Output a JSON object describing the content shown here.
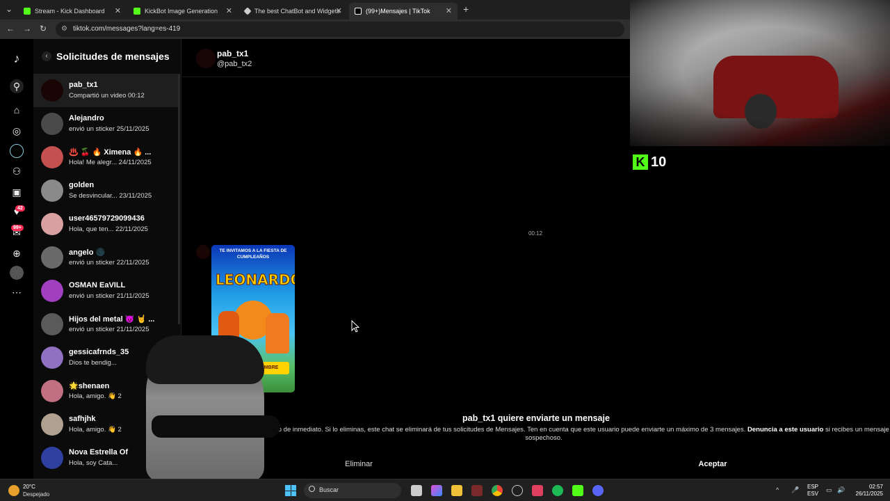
{
  "browser": {
    "tabs": [
      {
        "title": "Stream - Kick Dashboard",
        "color": "#53fc18"
      },
      {
        "title": "KickBot Image Generation",
        "color": "#53fc18"
      },
      {
        "title": "The best ChatBot and Widgets",
        "color": "#cccccc"
      },
      {
        "title": "(99+)Mensajes | TikTok",
        "color": "#ffffff"
      }
    ],
    "new_tab": "+",
    "url": "tiktok.com/messages?lang=es-419"
  },
  "rail": {
    "badge_activity": "42",
    "badge_messages": "99+"
  },
  "sidebar": {
    "title": "Solicitudes de mensajes",
    "requests": [
      {
        "name": "pab_tx1",
        "preview": "Compartió un video 00:12",
        "color": "#1a0505"
      },
      {
        "name": "Alejandro",
        "preview": "envió un sticker 25/11/2025",
        "color": "#4a4a4a"
      },
      {
        "name": "♨️ 🍒 🔥 Ximena 🔥 ...",
        "preview": "Hola! Me alegr... 24/11/2025",
        "color": "#c45050"
      },
      {
        "name": "golden",
        "preview": "Se desvincular... 23/11/2025",
        "color": "#8a8a8a"
      },
      {
        "name": "user46579729099436",
        "preview": "Hola, que ten... 22/11/2025",
        "color": "#d8a0a0"
      },
      {
        "name": "angelo 🌑",
        "preview": "envió un sticker 22/11/2025",
        "color": "#6a6a6a"
      },
      {
        "name": "OSMAN EaVILL",
        "preview": "envió un sticker 21/11/2025",
        "color": "#a040c0"
      },
      {
        "name": "Hijos del metal 😈 🤘 ...",
        "preview": "envió un sticker 21/11/2025",
        "color": "#5a5a5a"
      },
      {
        "name": "gessicafrnds_35",
        "preview": "Dios te bendig...",
        "color": "#9070c0"
      },
      {
        "name": "🌟shenaen",
        "preview": "Hola, amigo. 👋 2",
        "color": "#c07080"
      },
      {
        "name": "safhjhk",
        "preview": "Hola, amigo. 👋 2",
        "color": "#b0a090"
      },
      {
        "name": "Nova Estrella Of",
        "preview": "Hola, soy Cata...",
        "color": "#3040a0"
      }
    ]
  },
  "chat": {
    "name": "pab_tx1",
    "handle": "@pab_tx2",
    "time": "00:12",
    "video": {
      "banner": "TE INVITAMOS A LA FIESTA DE CUMPLEAÑOS",
      "title": "LEONARDO",
      "date": "SETIEMBRE"
    },
    "request_title": "pab_tx1 quiere enviarte un mensaje",
    "request_desc": "...a chatear con este usuario de inmediato. Si lo eliminas, este chat se eliminará de tus solicitudes de Mensajes. Ten en cuenta que este usuario puede enviarte un máximo de 3 mensajes.",
    "report_link": "Denuncia a este usuario",
    "report_suffix": "si recibes un mensaje sospechoso.",
    "delete_label": "Eliminar",
    "accept_label": "Aceptar"
  },
  "overlay": {
    "kick_logo": "K",
    "kick_count": "10"
  },
  "taskbar": {
    "temp": "20°C",
    "weather": "Despejado",
    "search_placeholder": "Buscar",
    "lang_1": "ESP",
    "lang_2": "ESV",
    "time": "02:57",
    "date": "26/11/2025"
  }
}
